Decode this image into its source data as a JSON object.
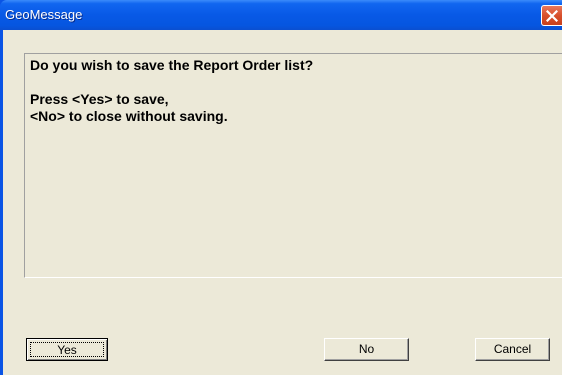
{
  "window": {
    "title": "GeoMessage",
    "close_icon": "close-icon"
  },
  "message": {
    "line1": "Do you wish to save the Report Order list?",
    "line2": "Press <Yes> to save,",
    "line3": "<No> to close without saving."
  },
  "buttons": {
    "yes_label": "Yes",
    "no_label": "No",
    "cancel_label": "Cancel"
  },
  "colors": {
    "titlebar": "#0859e6",
    "close_button": "#d8502c",
    "dialog_background": "#ece9d8"
  }
}
